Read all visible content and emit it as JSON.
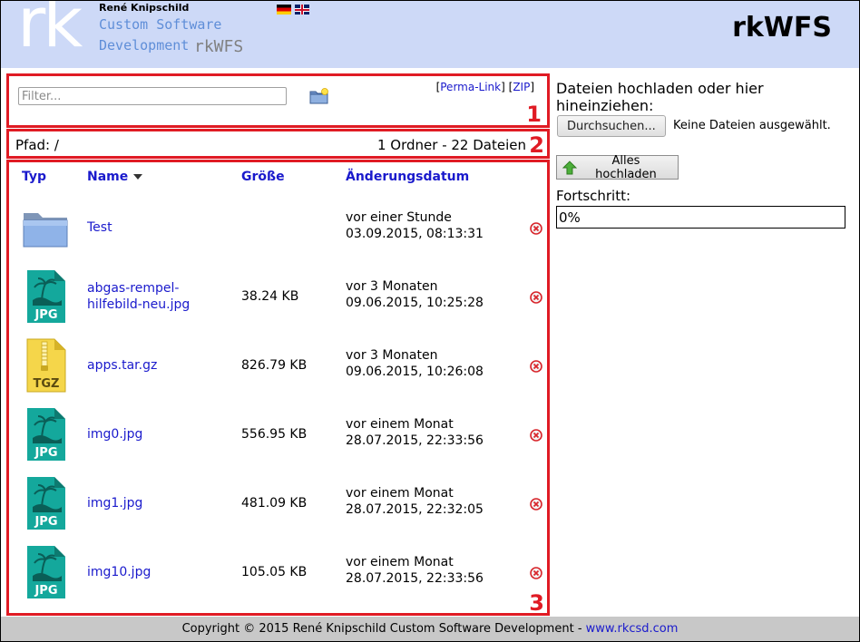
{
  "header": {
    "author": "René Knipschild",
    "logo_letters": "rk",
    "tagline_line1": "Custom Software",
    "tagline_line2": "Development",
    "app_name": "rkWFS",
    "title": "rkWFS"
  },
  "toolbar": {
    "filter_placeholder": "Filter...",
    "perma_link": "Perma-Link",
    "zip_link": "ZIP"
  },
  "path_bar": {
    "path": "Pfad: /",
    "counts": "1 Ordner - 22 Dateien"
  },
  "box_numbers": [
    "1",
    "2",
    "3"
  ],
  "table": {
    "headers": {
      "type": "Typ",
      "name": "Name",
      "size": "Größe",
      "date": "Änderungsdatum"
    },
    "rows": [
      {
        "icon": "folder-icon",
        "name": "Test",
        "size": "",
        "rel": "vor einer Stunde",
        "date": "03.09.2015, 08:13:31"
      },
      {
        "icon": "jpg-file-icon",
        "name": "abgas-rempel-hilfebild-neu.jpg",
        "size": "38.24 KB",
        "rel": "vor 3 Monaten",
        "date": "09.06.2015, 10:25:28"
      },
      {
        "icon": "tgz-file-icon",
        "name": "apps.tar.gz",
        "size": "826.79 KB",
        "rel": "vor 3 Monaten",
        "date": "09.06.2015, 10:26:08"
      },
      {
        "icon": "jpg-file-icon",
        "name": "img0.jpg",
        "size": "556.95 KB",
        "rel": "vor einem Monat",
        "date": "28.07.2015, 22:33:56"
      },
      {
        "icon": "jpg-file-icon",
        "name": "img1.jpg",
        "size": "481.09 KB",
        "rel": "vor einem Monat",
        "date": "28.07.2015, 22:32:05"
      },
      {
        "icon": "jpg-file-icon",
        "name": "img10.jpg",
        "size": "105.05 KB",
        "rel": "vor einem Monat",
        "date": "28.07.2015, 22:33:56"
      }
    ]
  },
  "upload": {
    "label": "Dateien hochladen oder hier hineinziehen:",
    "browse_label": "Durchsuchen...",
    "no_files": "Keine Dateien ausgewählt.",
    "upload_all_label": "Alles hochladen",
    "progress_label": "Fortschritt:",
    "progress_text": "0%",
    "progress_value": 0
  },
  "footer": {
    "copyright": "Copyright © 2015 René Knipschild Custom Software Development - ",
    "link": "www.rkcsd.com"
  },
  "colors": {
    "header_bg": "#cdd9f7",
    "link": "#1a1acc",
    "highlight_box": "#e01b24",
    "footer_bg": "#c8c8c8"
  }
}
